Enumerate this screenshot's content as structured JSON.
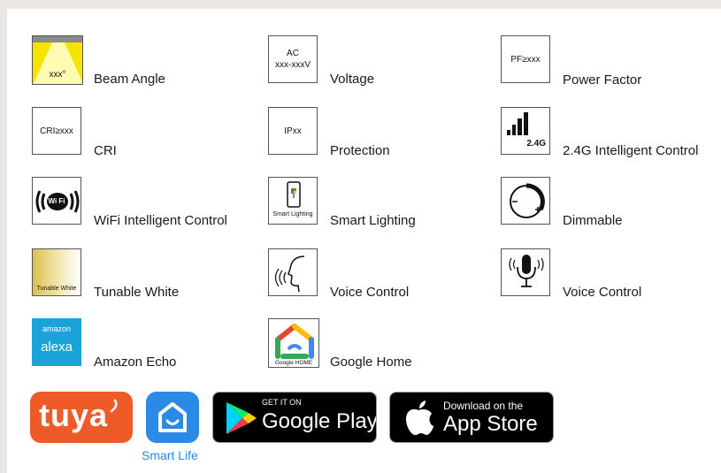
{
  "features": [
    {
      "id": "beam-angle",
      "label": "Beam Angle",
      "icon": "beam-angle-icon",
      "icon_text": "xxx°"
    },
    {
      "id": "voltage",
      "label": "Voltage",
      "icon": "voltage-icon",
      "icon_text_1": "AC",
      "icon_text_2": "xxx-xxxV"
    },
    {
      "id": "power-factor",
      "label": "Power Factor",
      "icon": "power-factor-icon",
      "icon_text": "PF≥xxx"
    },
    {
      "id": "cri",
      "label": "CRI",
      "icon": "cri-icon",
      "icon_text": "CRI≥xxx"
    },
    {
      "id": "protection",
      "label": "Protection",
      "icon": "protection-icon",
      "icon_text": "IPxx"
    },
    {
      "id": "intelligent-control-24g",
      "label": "2.4G Intelligent Control",
      "icon": "signal-bars-icon",
      "icon_text": "2.4G"
    },
    {
      "id": "wifi-control",
      "label": "WiFi Intelligent Control",
      "icon": "wifi-icon",
      "icon_text": "Wi Fi"
    },
    {
      "id": "smart-lighting",
      "label": "Smart Lighting",
      "icon": "smartphone-icon",
      "icon_text": "Smart Lighting"
    },
    {
      "id": "dimmable",
      "label": "Dimmable",
      "icon": "dimmer-knob-icon"
    },
    {
      "id": "tunable-white",
      "label": "Tunable White",
      "icon": "tunable-white-icon",
      "icon_text": "Tunable White"
    },
    {
      "id": "voice-control-head",
      "label": "Voice Control",
      "icon": "speaking-head-icon"
    },
    {
      "id": "voice-control-mic",
      "label": "Voice Control",
      "icon": "microphone-icon"
    },
    {
      "id": "amazon-echo",
      "label": "Amazon Echo",
      "icon": "alexa-icon",
      "icon_text_1": "amazon",
      "icon_text_2": "alexa"
    },
    {
      "id": "google-home",
      "label": "Google Home",
      "icon": "google-home-icon",
      "icon_text": "Google HOME"
    }
  ],
  "apps": {
    "tuya": {
      "logo_text": "tuya",
      "icon": "tuya-logo"
    },
    "smart_life": {
      "label": "Smart Life",
      "icon": "smart-life-home-icon"
    },
    "google_play": {
      "small_text": "GET IT ON",
      "big_text": "Google Play",
      "icon": "google-play-icon"
    },
    "app_store": {
      "small_text": "Download on the",
      "big_text": "App Store",
      "icon": "apple-icon"
    }
  },
  "colors": {
    "background": "#e9e6e3",
    "panel": "#ffffff",
    "beam_yellow": "#f5e400",
    "tuya_orange": "#ee5a28",
    "smart_life_blue": "#2a8ae6",
    "alexa_blue": "#1aa3d8",
    "store_black": "#000000"
  }
}
